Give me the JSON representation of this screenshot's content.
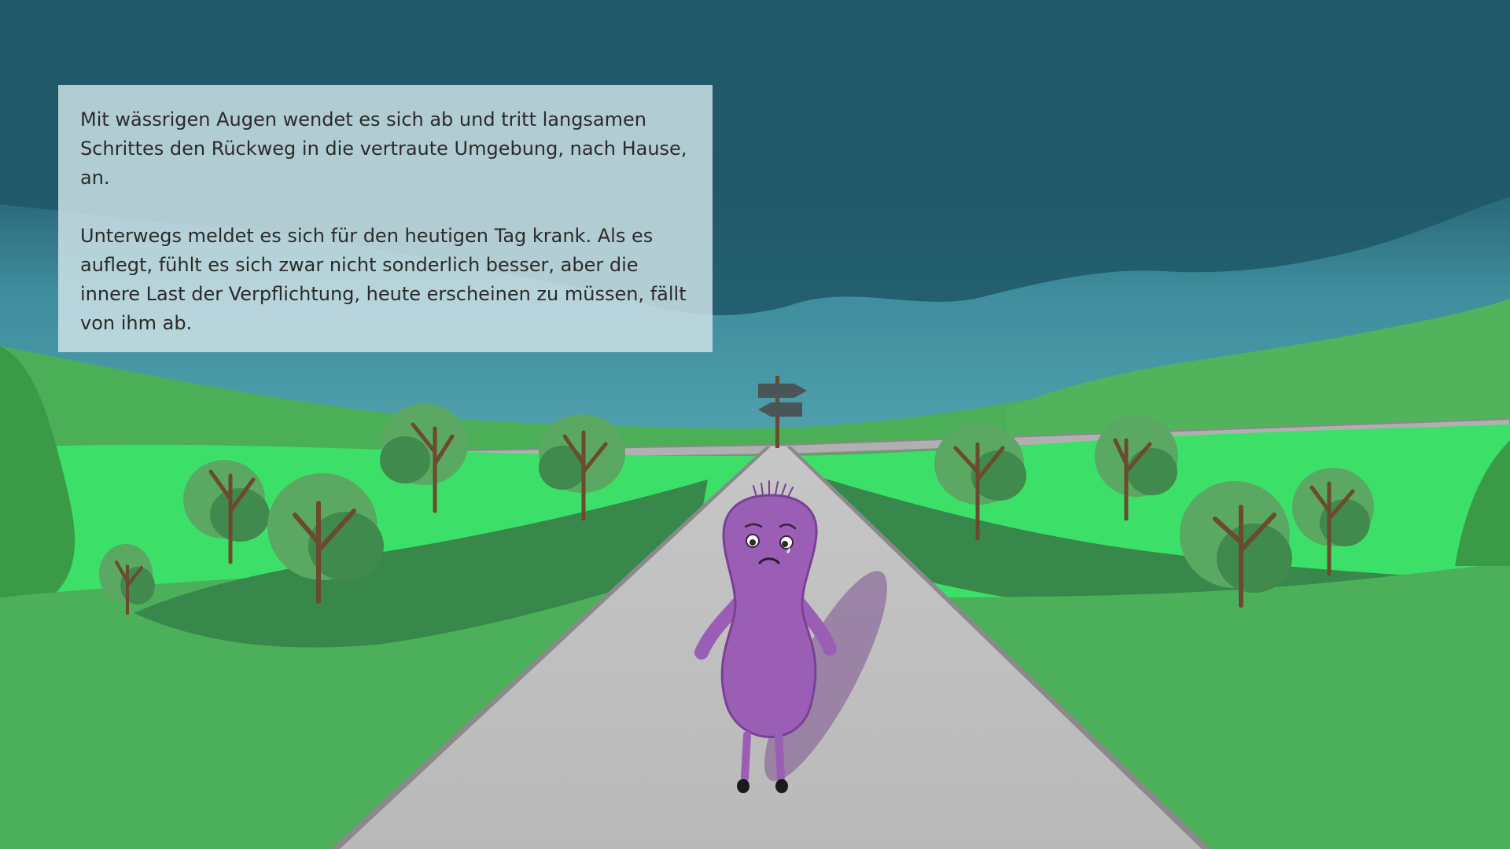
{
  "story": {
    "paragraphs": [
      "Mit wässrigen Augen wendet es sich ab und tritt langsamen Schrittes den Rückweg in die vertraute Umgebung, nach Hause, an.",
      "Unterwegs meldet es sich für den heutigen Tag krank. Als es auflegt, fühlt es sich zwar nicht sonderlich besser, aber die innere Last der Verpflichtung, heute erscheinen zu müssen, fällt von ihm ab."
    ]
  },
  "scene": {
    "sky_color": "#1f5a6a",
    "horizon_color": "#4a9aa8",
    "grass_color": "#4caf5a",
    "bright_grass_color": "#3ce068",
    "road_color": "#bdbdbd",
    "character_color": "#9a5fb5",
    "character_mood": "sad",
    "signpost_icon": "signpost-icon"
  }
}
